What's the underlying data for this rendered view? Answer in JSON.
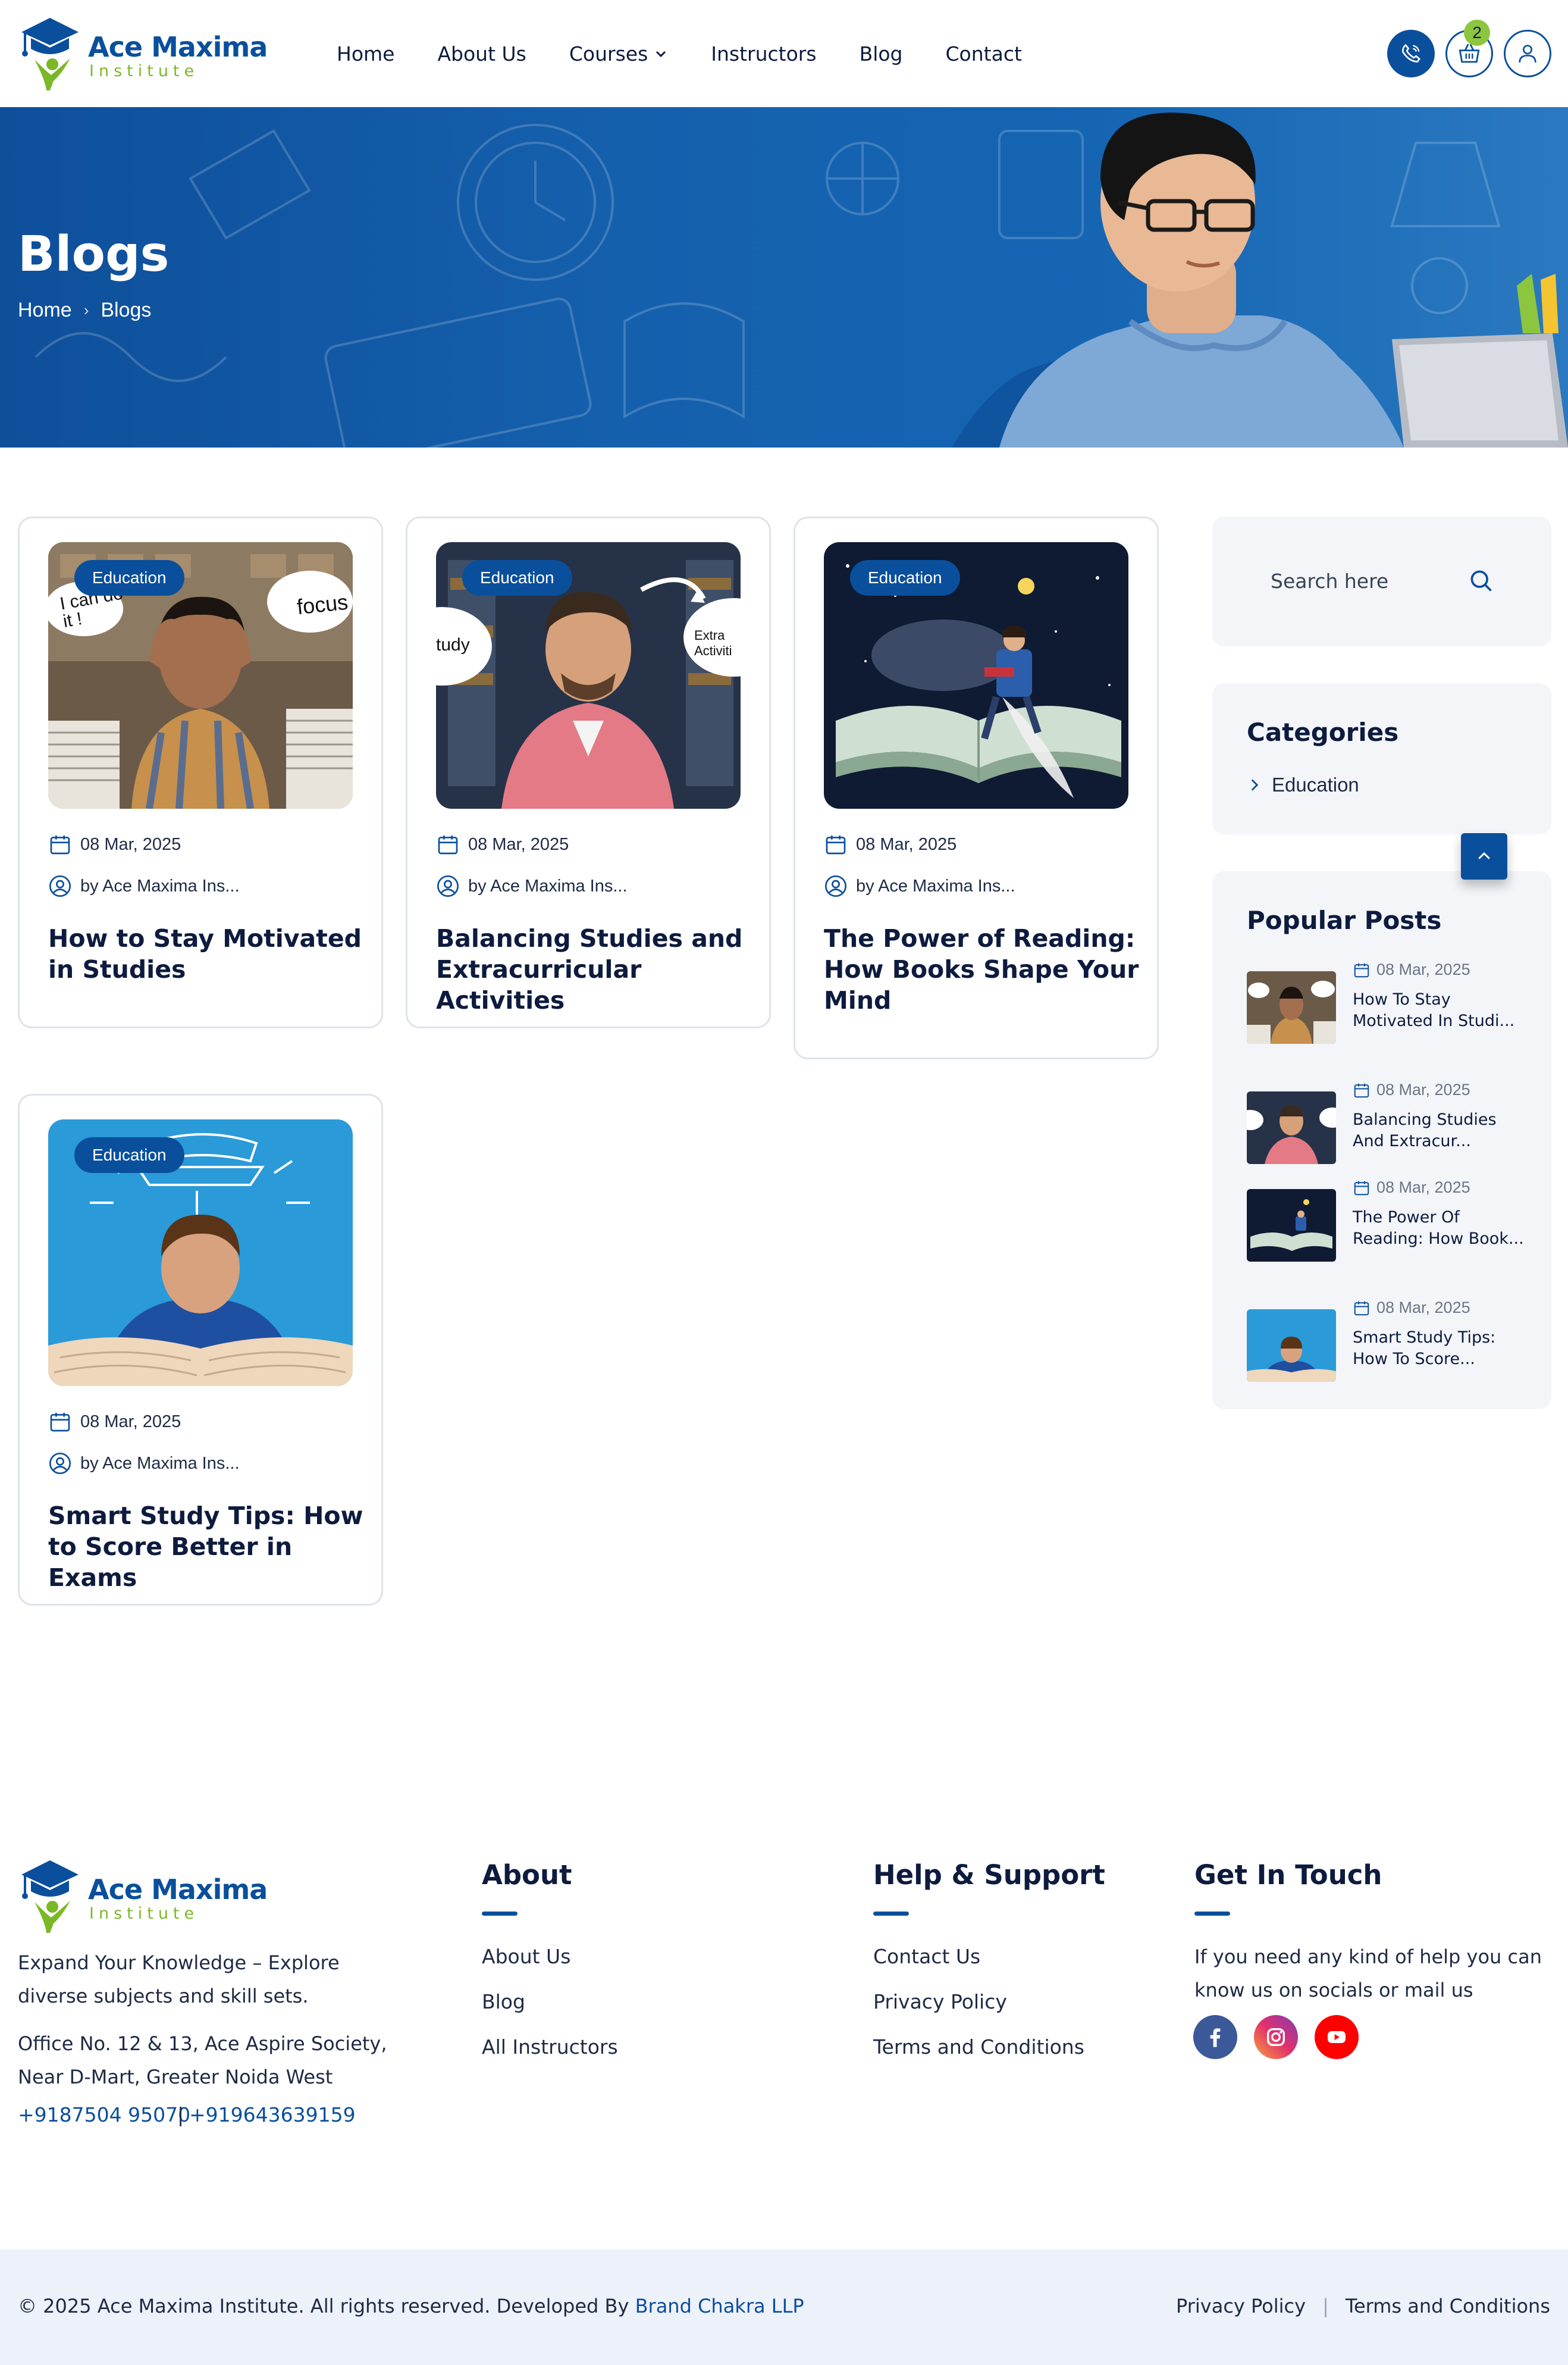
{
  "brand": {
    "name_line1": "Ace Maxima",
    "name_line2": "Institute",
    "colors": {
      "primary": "#0a4f9c",
      "accent": "#8cc63f",
      "text": "#0d1b3e",
      "muted_bg": "#f3f5f9"
    }
  },
  "nav": {
    "items": [
      "Home",
      "About Us",
      "Courses",
      "Instructors",
      "Blog",
      "Contact"
    ],
    "courses_has_dropdown": true
  },
  "header_icons": {
    "phone": "phone-icon",
    "cart": "basket-icon",
    "user": "user-icon",
    "cart_count": "2"
  },
  "banner": {
    "title": "Blogs",
    "breadcrumb": [
      "Home",
      "Blogs"
    ],
    "breadcrumb_separator": "›"
  },
  "posts": [
    {
      "tag": "Education",
      "date": "08 Mar, 2025",
      "author": "by  Ace Maxima Ins...",
      "title": "How to Stay Motivated in Studies"
    },
    {
      "tag": "Education",
      "date": "08 Mar, 2025",
      "author": "by  Ace Maxima Ins...",
      "title": "Balancing Studies and Extracurricular Activities"
    },
    {
      "tag": "Education",
      "date": "08 Mar, 2025",
      "author": "by  Ace Maxima Ins...",
      "title": "The Power of Reading: How Books Shape Your Mind"
    },
    {
      "tag": "Education",
      "date": "08 Mar, 2025",
      "author": "by  Ace Maxima Ins...",
      "title": "Smart Study Tips: How to Score Better in Exams"
    }
  ],
  "image_texts": {
    "post1_bubble_left": "I can do it !",
    "post1_bubble_right": "focus",
    "post2_bubble_left": "tudy",
    "post2_bubble_right": "Extra Activiti"
  },
  "sidebar": {
    "search_placeholder": "Search here",
    "categories_heading": "Categories",
    "categories": [
      "Education"
    ],
    "popular_heading": "Popular Posts",
    "popular": [
      {
        "date": "08 Mar, 2025",
        "title": "How To Stay Motivated In Studi..."
      },
      {
        "date": "08 Mar, 2025",
        "title": "Balancing Studies And Extracur..."
      },
      {
        "date": "08 Mar, 2025",
        "title": "The Power Of Reading: How Book..."
      },
      {
        "date": "08 Mar, 2025",
        "title": "Smart Study Tips: How To Score..."
      }
    ]
  },
  "footer": {
    "tagline": "Expand Your Knowledge – Explore diverse subjects and skill sets.",
    "address": "Office No. 12 & 13, Ace Aspire Society, Near D-Mart, Greater Noida West",
    "phone1": "+9187504 95070",
    "phone_sep": "|",
    "phone2": "+919643639159",
    "about_heading": "About",
    "about_links": [
      "About Us",
      "Blog",
      "All Instructors"
    ],
    "help_heading": "Help & Support",
    "help_links": [
      "Contact Us",
      "Privacy Policy",
      "Terms and Conditions"
    ],
    "touch_heading": "Get In Touch",
    "touch_text": "If you need any kind of help you can know us on socials or mail us",
    "socials": [
      "facebook-icon",
      "instagram-icon",
      "youtube-icon"
    ],
    "copyright": "© 2025 Ace Maxima Institute. All rights reserved. Developed By",
    "developer": "Brand Chakra LLP",
    "bottom_links": [
      "Privacy Policy",
      "Terms and Conditions"
    ],
    "bottom_sep": "|"
  }
}
